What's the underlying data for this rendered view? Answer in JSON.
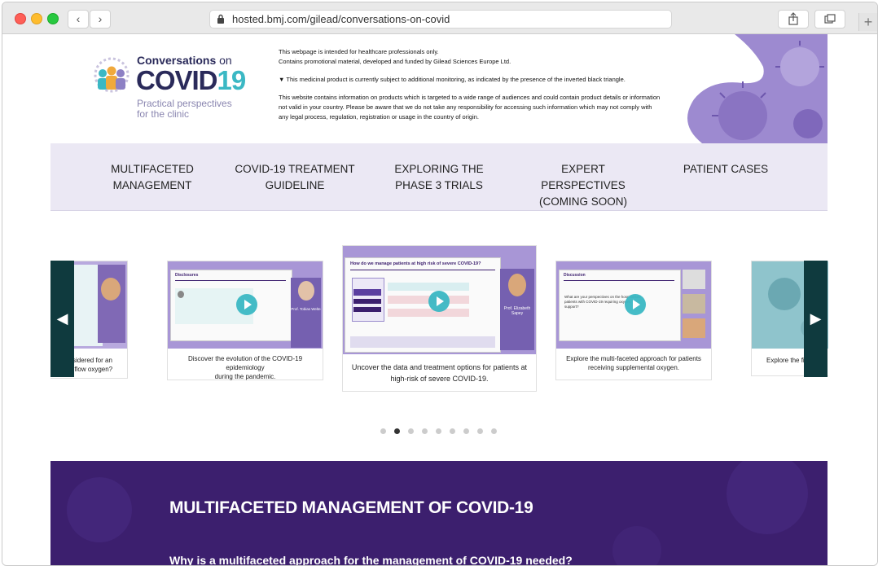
{
  "browser": {
    "url": "hosted.bmj.com/gilead/conversations-on-covid",
    "back_icon": "‹",
    "forward_icon": "›",
    "new_tab_icon": "+"
  },
  "logo": {
    "line1": "Conversations",
    "line1_suffix": "on",
    "line2_a": "COVID",
    "line2_b": "19",
    "line3": "Practical perspectives for the clinic"
  },
  "disclaimer": {
    "p1a": "This webpage is intended for healthcare professionals only.",
    "p1b": "Contains promotional material, developed and funded by Gilead Sciences Europe Ltd.",
    "p2": "▼ This medicinal product is currently subject to additional monitoring, as indicated by the presence of the inverted black triangle.",
    "p3": "This website contains information on products which is targeted to a wide range of audiences and could contain product details or information not valid in your country. Please be aware that we do not take any responsibility for accessing such information which may not comply with any legal process, regulation, registration or usage in the country of origin."
  },
  "nav": [
    {
      "l1": "MULTIFACETED",
      "l2": "MANAGEMENT"
    },
    {
      "l1": "COVID-19 TREATMENT",
      "l2": "GUIDELINE"
    },
    {
      "l1": "EXPLORING THE",
      "l2": "PHASE 3 TRIALS"
    },
    {
      "l1": "EXPERT PERSPECTIVES",
      "l2": "(COMING SOON)"
    },
    {
      "l1": "PATIENT CASES",
      "l2": ""
    }
  ],
  "carousel": {
    "prev_icon": "◀",
    "next_icon": "▶",
    "cards": [
      {
        "caption_l1": "onsidered for an",
        "caption_l2": "gh-flow oxygen?"
      },
      {
        "caption_l1": "Discover the evolution of the COVID-19 epidemiology",
        "caption_l2": "during the pandemic.",
        "slide_title": "Disclosures",
        "speaker": "Prof. Tobias Welte"
      },
      {
        "caption_l1": "Uncover the data and treatment options for patients at",
        "caption_l2": "high-risk of severe COVID-19.",
        "slide_title": "How do we manage patients at high risk of severe COVID-19?",
        "speaker": "Prof. Elizabeth Sapey"
      },
      {
        "caption_l1": "Explore the multi-faceted approach for patients",
        "caption_l2": "receiving supplemental oxygen.",
        "slide_title": "Discussion",
        "slide_text": "What are your perspectives on the hospitalised patients with COVID-19 requiring oxygen support?"
      },
      {
        "caption_l1": "Explore the fina",
        "caption_l2": ""
      }
    ],
    "dots_count": 9,
    "active_dot": 1
  },
  "section": {
    "heading": "MULTIFACETED MANAGEMENT OF COVID-19",
    "subheading": "Why is a multifaceted approach for the management of COVID-19 needed?"
  }
}
